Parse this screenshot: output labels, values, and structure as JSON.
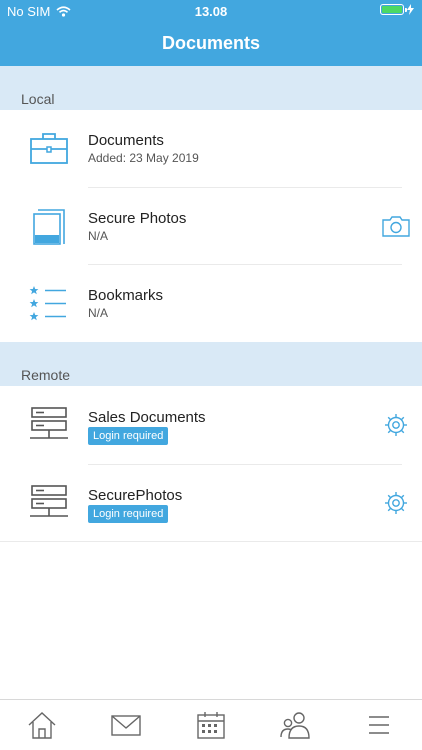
{
  "status_bar": {
    "carrier": "No SIM",
    "time": "13.08"
  },
  "header": {
    "title": "Documents"
  },
  "sections": [
    {
      "label": "Local",
      "items": [
        {
          "name": "Documents",
          "subtitle": "Added: 23 May 2019",
          "icon": "briefcase-icon"
        },
        {
          "name": "Secure Photos",
          "subtitle": "N/A",
          "icon": "photos-icon",
          "action_icon": "camera-icon"
        },
        {
          "name": "Bookmarks",
          "subtitle": "N/A",
          "icon": "bookmarks-icon"
        }
      ]
    },
    {
      "label": "Remote",
      "items": [
        {
          "name": "Sales Documents",
          "badge": "Login required",
          "icon": "server-icon",
          "action_icon": "gear-icon"
        },
        {
          "name": "SecurePhotos",
          "badge": "Login required",
          "icon": "server-icon",
          "action_icon": "gear-icon"
        }
      ]
    }
  ],
  "tabbar": {
    "items": [
      {
        "icon": "home-icon"
      },
      {
        "icon": "mail-icon"
      },
      {
        "icon": "calendar-icon"
      },
      {
        "icon": "contacts-icon"
      },
      {
        "icon": "menu-icon"
      }
    ]
  },
  "colors": {
    "accent": "#42a7df",
    "section_bg": "#d9e9f6",
    "battery": "#4cd964"
  }
}
